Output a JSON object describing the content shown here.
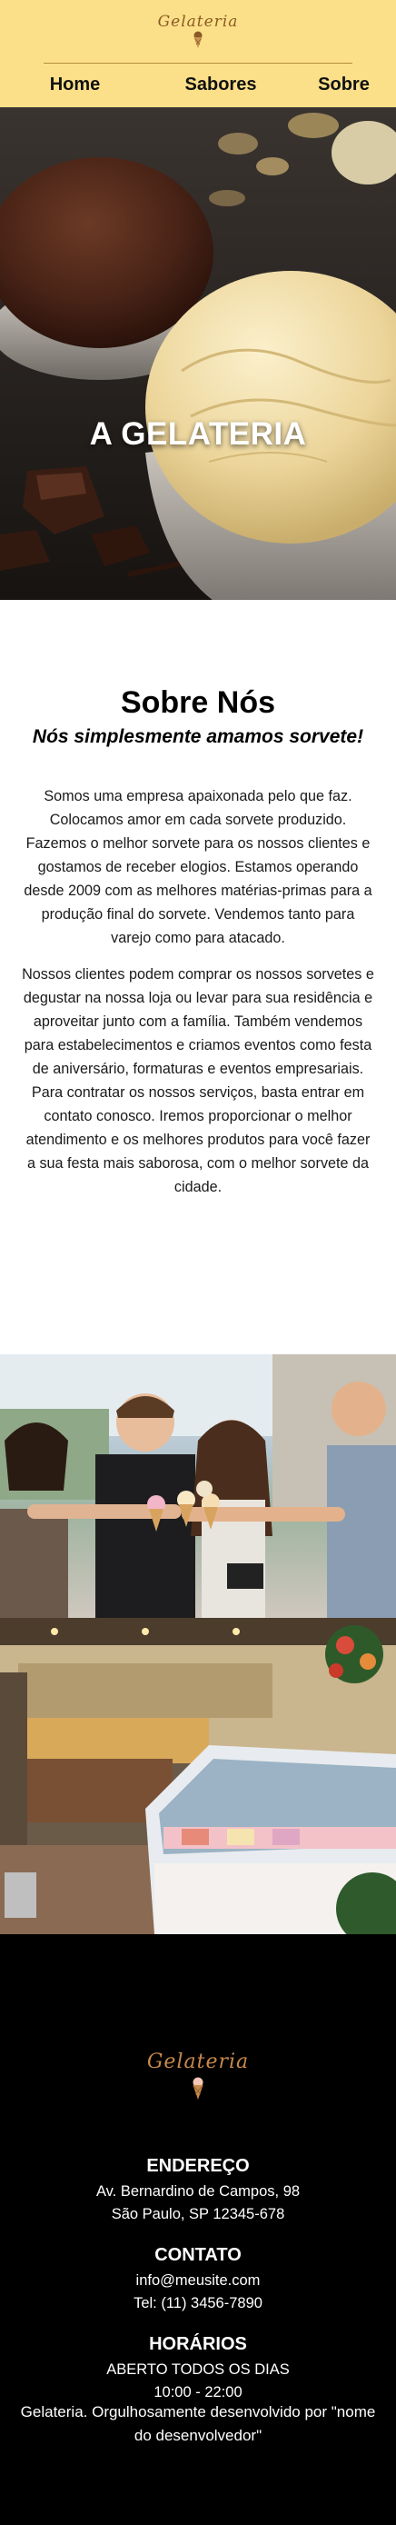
{
  "brand": {
    "name": "Gelateria"
  },
  "nav": {
    "items": [
      "Home",
      "Sabores",
      "Sobre"
    ]
  },
  "hero": {
    "title": "A GELATERIA"
  },
  "about": {
    "title": "Sobre Nós",
    "subtitle": "Nós simplesmente amamos sorvete!",
    "paragraphs": [
      "Somos uma empresa apaixonada pelo que faz. Colocamos amor em cada sorvete produzido. Fazemos o melhor sorvete para os nossos clientes e gostamos de receber elogios. Estamos operando desde 2009 com as melhores matérias-primas para a produção final do sorvete. Vendemos tanto para varejo como para atacado.",
      "Nossos clientes podem comprar os nossos sorvetes e degustar na nossa loja ou levar para sua residência e aproveitar junto com a família. Também vendemos para estabelecimentos e criamos eventos como festa de aniversário, formaturas e eventos empresariais. Para contratar os nossos serviços, basta entrar em contato conosco. Iremos proporcionar o melhor atendimento e os melhores produtos para você fazer a sua festa mais saborosa, com o melhor sorvete da cidade."
    ]
  },
  "footer": {
    "address_title": "ENDEREÇO",
    "address_line1": "Av. Bernardino de Campos, 98",
    "address_line2": "São Paulo, SP 12345-678",
    "contact_title": "CONTATO",
    "email": "info@meusite.com",
    "phone": "Tel: (11) 3456-7890",
    "hours_title": "HORÁRIOS",
    "hours_line1": "ABERTO TODOS OS DIAS",
    "hours_line2": "10:00 - 22:00",
    "credit": "Gelateria. Orgulhosamente desenvolvido por \"nome do desenvolvedor\""
  },
  "colors": {
    "header_bg": "#fbe089",
    "footer_bg": "#000000",
    "logo": "#8a5a26",
    "footer_logo": "#c7894b"
  },
  "icons": [
    "ice-cream-cone-icon"
  ]
}
